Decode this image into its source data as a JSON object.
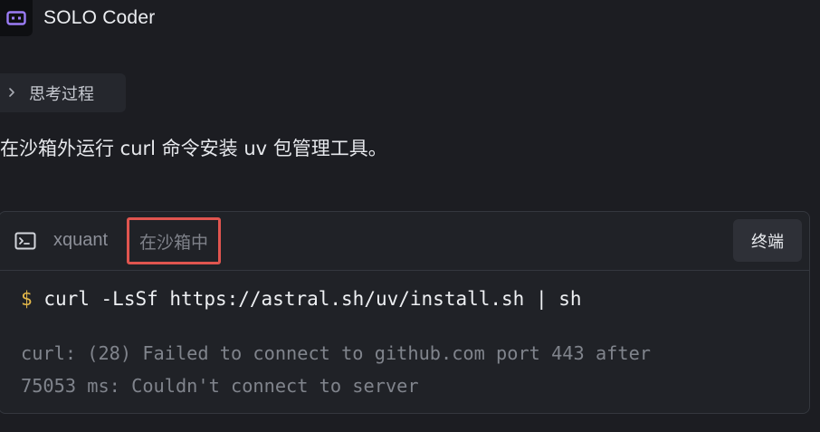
{
  "app": {
    "name": "SOLO Coder",
    "icon": "robot-face-icon"
  },
  "thinking": {
    "label": "思考过程",
    "icon": "chevron-right-icon"
  },
  "message": {
    "text": "在沙箱外运行 curl 命令安装 uv 包管理工具。"
  },
  "terminal": {
    "icon": "terminal-icon",
    "workspace": "xquant",
    "sandbox_status": "在沙箱中",
    "open_terminal_label": "终端",
    "prompt_symbol": "$",
    "command": "curl -LsSf https://astral.sh/uv/install.sh | sh",
    "output_lines": [
      "curl: (28) Failed to connect to github.com port 443 after",
      "75053 ms: Couldn't connect to server"
    ]
  },
  "colors": {
    "background": "#1c1d22",
    "card": "#202227",
    "logo_accent": "#9b7cf6",
    "prompt": "#e5b94a",
    "highlight_border": "#e0554f"
  }
}
